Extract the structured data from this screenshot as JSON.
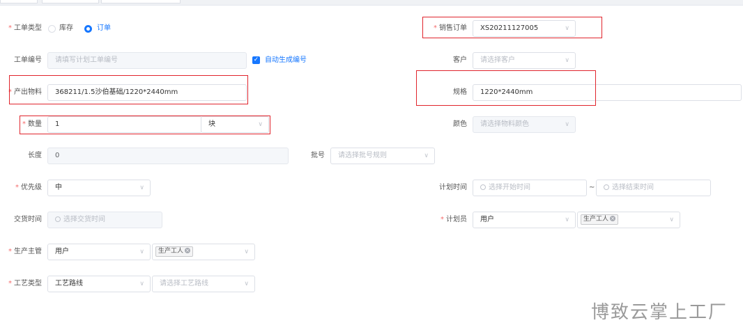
{
  "form": {
    "order_type": {
      "label": "工单类型",
      "options": [
        "库存",
        "订单"
      ],
      "selected": "订单"
    },
    "sales_order": {
      "label": "销售订单",
      "value": "XS20211127005"
    },
    "order_no": {
      "label": "工单编号",
      "placeholder": "请填写计划工单编号",
      "auto_label": "自动生成编号",
      "auto_checked": true
    },
    "customer": {
      "label": "客户",
      "placeholder": "请选择客户"
    },
    "material": {
      "label": "产出物料",
      "value": "368211/1.5沙伯基础/1220*2440mm"
    },
    "spec": {
      "label": "规格",
      "value": "1220*2440mm"
    },
    "quantity": {
      "label": "数量",
      "value": "1",
      "unit": "块"
    },
    "color": {
      "label": "颜色",
      "placeholder": "请选择物料颜色"
    },
    "length": {
      "label": "长度",
      "value": "0"
    },
    "batch": {
      "label": "批号",
      "placeholder": "请选择批号规则"
    },
    "priority": {
      "label": "优先级",
      "value": "中"
    },
    "plan_time": {
      "label": "计划时间",
      "start_placeholder": "选择开始时间",
      "separator": "~",
      "end_placeholder": "选择结束时间"
    },
    "delivery_time": {
      "label": "交货时间",
      "placeholder": "选择交货时间"
    },
    "planner": {
      "label": "计划员",
      "value": "用户",
      "tag": "生产工人"
    },
    "supervisor": {
      "label": "生产主管",
      "value": "用户",
      "tag": "生产工人"
    },
    "process_type": {
      "label": "工艺类型",
      "value": "工艺路线",
      "route_placeholder": "请选择工艺路线"
    }
  },
  "watermark": "博致云掌上工厂",
  "colors": {
    "accent": "#1677ff",
    "required": "#f56c6c",
    "highlight_box": "#e0242c"
  }
}
